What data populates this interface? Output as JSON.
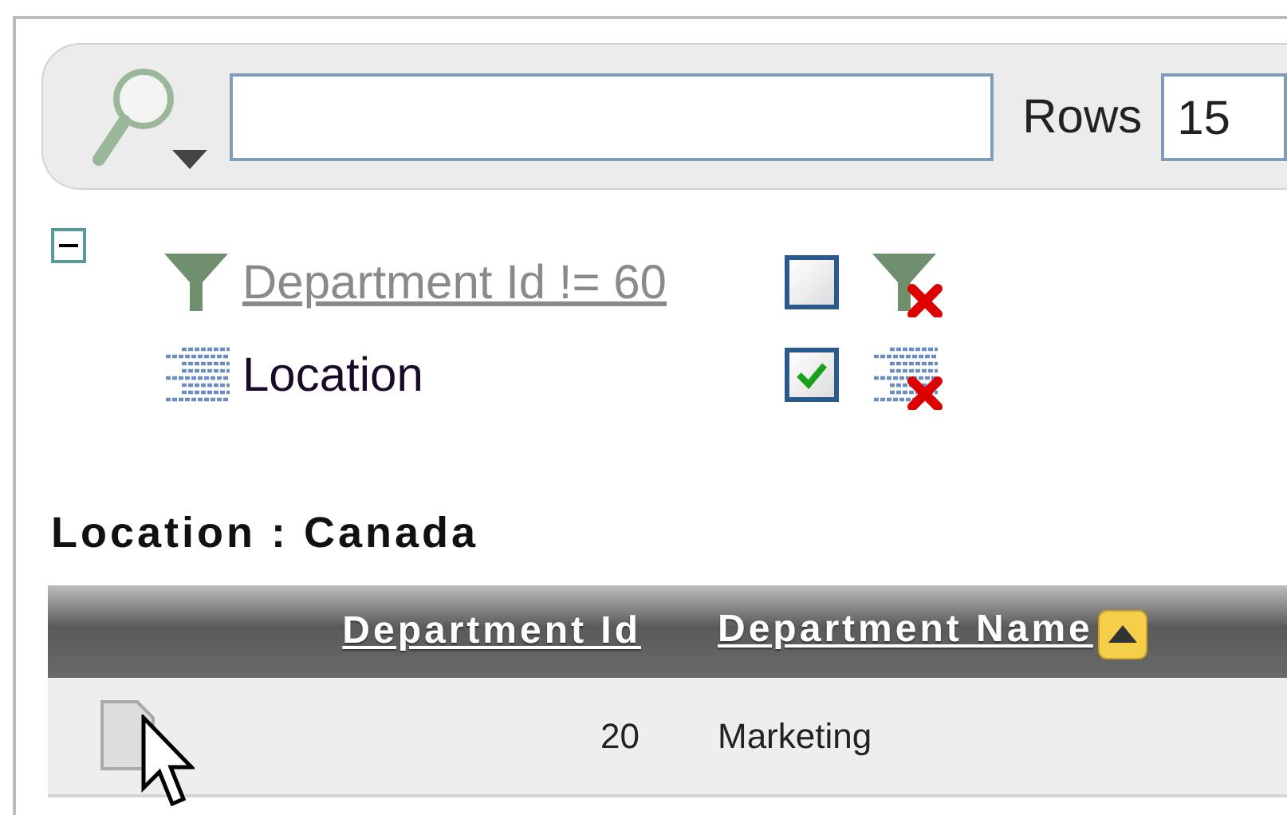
{
  "search": {
    "rows_label": "Rows",
    "rows_value": "15"
  },
  "control_panel": {
    "expanded": true
  },
  "filters": [
    {
      "kind": "filter",
      "label": "Department Id != 60",
      "enabled": false
    },
    {
      "kind": "break",
      "label": "Location",
      "enabled": true
    }
  ],
  "group_heading": "Location : Canada",
  "table": {
    "columns": [
      {
        "label": "Department Id",
        "sorted": false
      },
      {
        "label": "Department Name",
        "sorted": true
      }
    ],
    "rows": [
      [
        "20",
        "Marketing"
      ]
    ]
  }
}
